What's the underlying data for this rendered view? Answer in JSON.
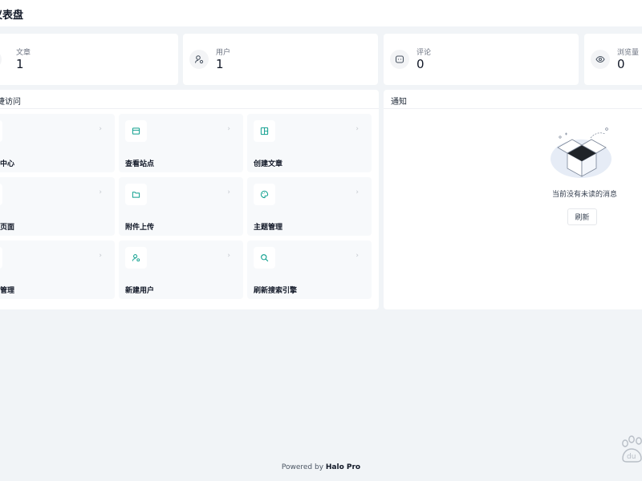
{
  "header": {
    "title": "仪表盘"
  },
  "stats": [
    {
      "label": "文章",
      "value": "1",
      "icon": "document-icon"
    },
    {
      "label": "用户",
      "value": "1",
      "icon": "user-icon"
    },
    {
      "label": "评论",
      "value": "0",
      "icon": "comment-icon"
    },
    {
      "label": "浏览量",
      "value": "0",
      "icon": "eye-icon"
    }
  ],
  "quick_access": {
    "title": "快捷访问",
    "items": [
      {
        "label": "个人中心",
        "icon": "user-circle-icon"
      },
      {
        "label": "查看站点",
        "icon": "browser-window-icon"
      },
      {
        "label": "创建文章",
        "icon": "layout-icon"
      },
      {
        "label": "创建页面",
        "icon": "page-icon"
      },
      {
        "label": "附件上传",
        "icon": "folder-icon"
      },
      {
        "label": "主题管理",
        "icon": "palette-icon"
      },
      {
        "label": "插件管理",
        "icon": "plugin-icon"
      },
      {
        "label": "新建用户",
        "icon": "user-add-icon"
      },
      {
        "label": "刷新搜索引擎",
        "icon": "search-icon"
      }
    ]
  },
  "notifications": {
    "title": "通知",
    "empty_message": "当前没有未读的消息",
    "refresh_label": "刷新"
  },
  "footer": {
    "prefix": "Powered by ",
    "brand": "Halo Pro"
  },
  "colors": {
    "accent": "#0e9f8e",
    "background": "#f1f4f7",
    "card": "#ffffff",
    "tile": "#f7f9fb"
  }
}
